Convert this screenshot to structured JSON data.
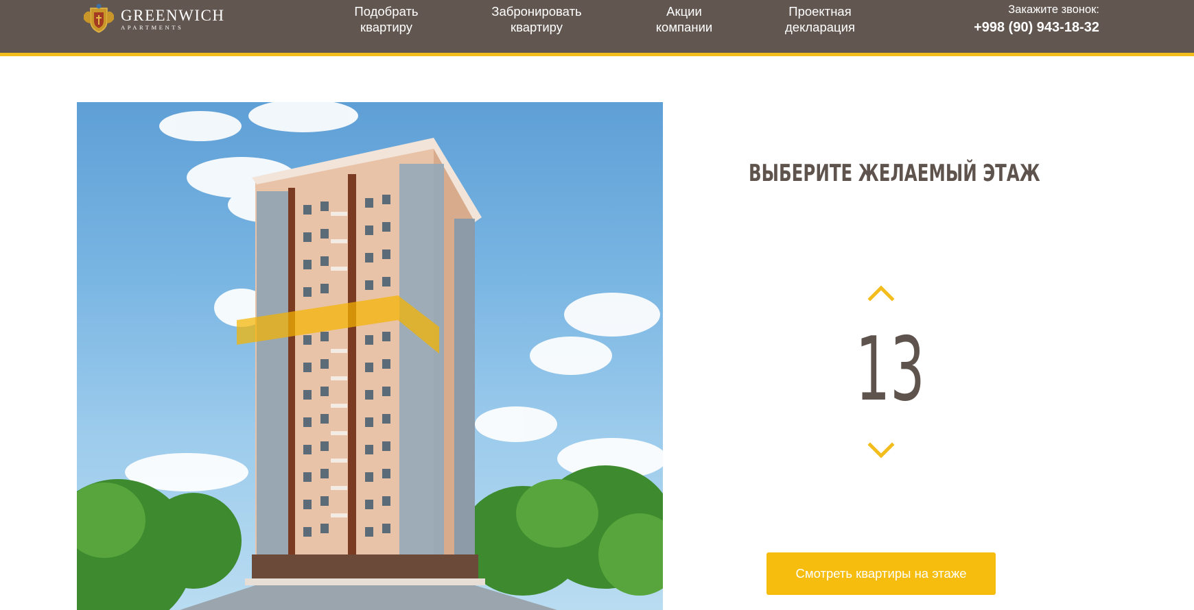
{
  "header": {
    "logo": {
      "name": "GREENWICH",
      "sub": "APARTMENTS",
      "icon": "crest-icon"
    },
    "nav": [
      {
        "line1": "Подобрать",
        "line2": "квартиру"
      },
      {
        "line1": "Забронировать",
        "line2": "квартиру"
      },
      {
        "line1": "Акции",
        "line2": "компании"
      },
      {
        "line1": "Проектная",
        "line2": "декларация"
      }
    ],
    "callback": {
      "label": "Закажите звонок:",
      "phone": "+998 (90) 943-18-32"
    }
  },
  "floor_selector": {
    "title": "ВЫБЕРИТЕ ЖЕЛАЕМЫЙ ЭТАЖ",
    "floor": "13",
    "up_icon": "chevron-up-icon",
    "down_icon": "chevron-down-icon",
    "button": "Смотреть квартиры на этаже"
  },
  "colors": {
    "header_bg": "#625650",
    "accent": "#f2bd1d",
    "text_dark": "#5f534d"
  }
}
